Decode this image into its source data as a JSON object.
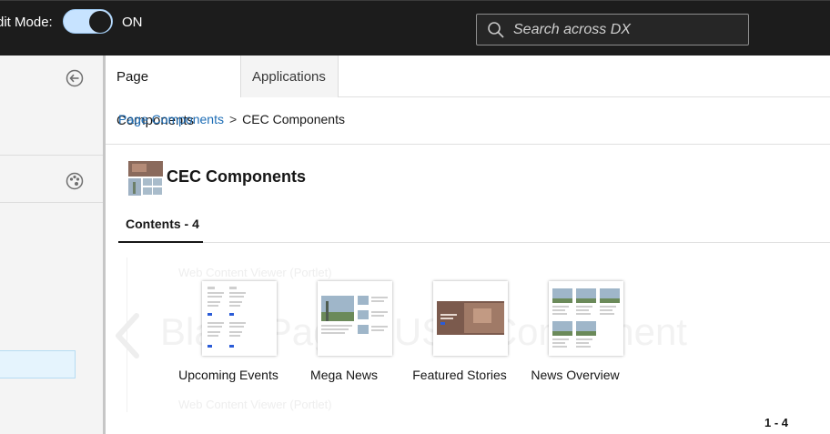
{
  "topbar": {
    "edit_mode_label": "dit Mode:",
    "toggle_state": "ON",
    "search_placeholder": "Search across DX"
  },
  "main": {
    "tabs": [
      {
        "label": "Page Components"
      },
      {
        "label": "Applications"
      }
    ],
    "breadcrumb": {
      "link": "Page Components",
      "separator": ">",
      "current": "CEC Components"
    },
    "folder_title": "CEC Components",
    "contents_tab": "Contents - 4",
    "ghost": {
      "big_text": "Blank Page CUS... Component",
      "line1": "Web Content Viewer (Portlet)",
      "line2": "Web Content Viewer (Portlet)"
    },
    "items": [
      {
        "label": "Upcoming Events"
      },
      {
        "label": "Mega News"
      },
      {
        "label": "Featured Stories"
      },
      {
        "label": "News Overview"
      }
    ],
    "pager": "1 - 4"
  },
  "colors": {
    "topbar_bg": "#1c1c1c",
    "toggle_on": "#c7e3ff",
    "link": "#1c6cb5",
    "selected_row": "#e5f4fd"
  }
}
